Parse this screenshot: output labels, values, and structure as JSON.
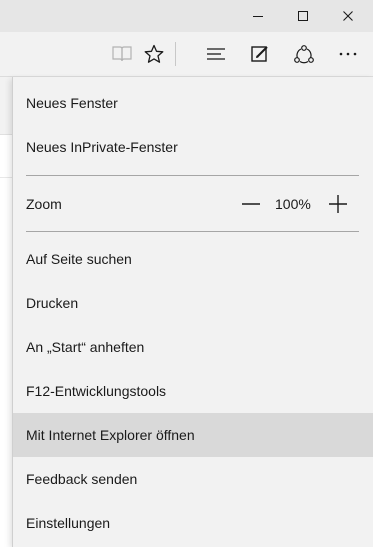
{
  "window_controls": {
    "minimize": "minimize-icon",
    "maximize": "maximize-icon",
    "close": "close-icon"
  },
  "toolbar": {
    "reading_view": "book-icon",
    "favorites": "star-icon",
    "hub": "hub-lines-icon",
    "web_note": "pen-note-icon",
    "share": "share-icon",
    "more": "more-dots-icon"
  },
  "menu": {
    "new_window": "Neues Fenster",
    "new_inprivate": "Neues InPrivate-Fenster",
    "zoom_label": "Zoom",
    "zoom_value": "100%",
    "find_on_page": "Auf Seite suchen",
    "print": "Drucken",
    "pin_start": "An „Start“ anheften",
    "f12_tools": "F12-Entwicklungstools",
    "open_ie": "Mit Internet Explorer öffnen",
    "feedback": "Feedback senden",
    "settings": "Einstellungen"
  },
  "colors": {
    "titlebar": "#e6e6e6",
    "toolbar": "#f2f2f2",
    "menu_bg": "#f2f2f2",
    "highlight": "#d9d9d9",
    "separator": "#a6a6a6"
  }
}
